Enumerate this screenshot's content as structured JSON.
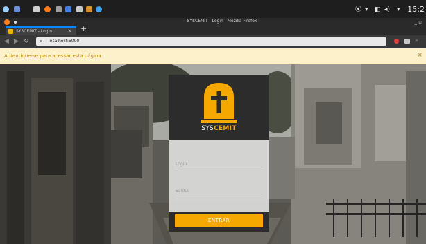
{
  "system": {
    "clock": "15:2",
    "tray_icons": [
      "network-icon",
      "wifi-icon",
      "audio-icon",
      "volume-icon",
      "chevron-down-icon"
    ]
  },
  "window": {
    "title": "SYSCEMIT - Login - Mozilla Firefox",
    "controls": "_ ▫"
  },
  "browser": {
    "tab_title": "SYSCEMIT - Login",
    "tab_close": "×",
    "new_tab": "+",
    "url": "localhost:5000",
    "overflow": "»"
  },
  "notification": {
    "message": "Autentique-se para acessar esta página",
    "close": "×"
  },
  "login": {
    "brand_part1": "SYS",
    "brand_part2": "CEMIT",
    "login_placeholder": "Login",
    "senha_placeholder": "Senha",
    "submit_label": "ENTRAR"
  },
  "colors": {
    "accent": "#f5a800",
    "card_dark": "#2c2c2c",
    "notification_bg": "#fdf1cc",
    "notification_text": "#c18a00"
  }
}
